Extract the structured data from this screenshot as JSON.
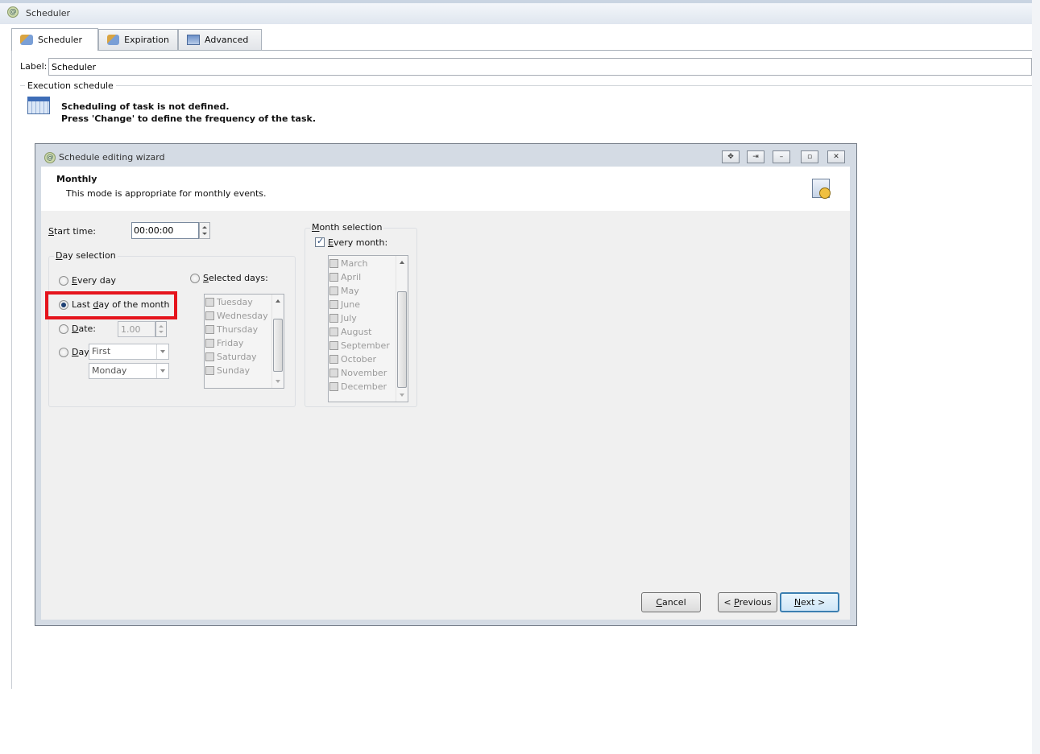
{
  "window": {
    "title": "Scheduler"
  },
  "tabs": [
    {
      "label": "Scheduler",
      "active": true,
      "icon": "scheduler-icon"
    },
    {
      "label": "Expiration",
      "active": false,
      "icon": "expiration-icon"
    },
    {
      "label": "Advanced",
      "active": false,
      "icon": "advanced-icon"
    }
  ],
  "label_field": {
    "label": "Label:",
    "value": "Scheduler"
  },
  "execution": {
    "legend": "Execution schedule",
    "message_line1": "Scheduling of task is not defined.",
    "message_line2": "Press 'Change' to define the frequency of the task."
  },
  "wizard": {
    "title": "Schedule editing wizard",
    "mode_title": "Monthly",
    "mode_desc": "This mode is appropriate for monthly events.",
    "start_time": {
      "label_pre": "S",
      "label_post": "tart time:",
      "value": "00:00:00"
    },
    "day_selection": {
      "legend_pre": "D",
      "legend_post": "ay selection",
      "every_day": {
        "pre": "E",
        "post": "very day"
      },
      "last_day": {
        "pre": "Last ",
        "ul": "d",
        "post": "ay of the month",
        "checked": true
      },
      "date": {
        "pre": "D",
        "post": "ate:",
        "value": "1.00"
      },
      "day": {
        "pre": "D",
        "post": "ay",
        "ordinal": "First",
        "weekday": "Monday"
      },
      "selected_days": {
        "pre": "S",
        "post": "elected days:"
      },
      "days": [
        "Tuesday",
        "Wednesday",
        "Thursday",
        "Friday",
        "Saturday",
        "Sunday"
      ]
    },
    "month_selection": {
      "legend_pre": "M",
      "legend_post": "onth selection",
      "every_month": {
        "pre": "E",
        "post": "very month:",
        "checked": true
      },
      "months": [
        "March",
        "April",
        "May",
        "June",
        "July",
        "August",
        "September",
        "October",
        "November",
        "December"
      ]
    },
    "buttons": {
      "cancel": {
        "pre": "C",
        "post": "ancel"
      },
      "previous": {
        "pre": "< P",
        "post": "revious"
      },
      "next": {
        "pre": "N",
        "post": "ext >"
      }
    },
    "window_buttons": [
      "move-icon",
      "restore-icon",
      "minimize-icon",
      "maximize-icon",
      "close-icon"
    ]
  },
  "colors": {
    "highlight": "#e5141c",
    "wizard_frame": "#d4dbe4",
    "default_button": "#3c7fb1"
  }
}
